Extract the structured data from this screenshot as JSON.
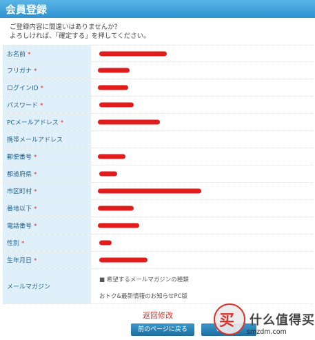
{
  "header": {
    "title": "会員登録"
  },
  "intro": {
    "line1": "ご登録内容に間違いはありませんか？",
    "line2": "よろしければ、「確定する」を押してください。"
  },
  "fields": [
    {
      "label": "お名前",
      "required": true
    },
    {
      "label": "フリガナ",
      "required": true
    },
    {
      "label": "ログインID",
      "required": true
    },
    {
      "label": "パスワード",
      "required": true
    },
    {
      "label": "PCメールアドレス",
      "required": true
    },
    {
      "label": "携帯メールアドレス",
      "required": false
    },
    {
      "label": "郵便番号",
      "required": true
    },
    {
      "label": "都道府県",
      "required": true
    },
    {
      "label": "市区町村",
      "required": true
    },
    {
      "label": "番地以下",
      "required": true
    },
    {
      "label": "電話番号",
      "required": true
    },
    {
      "label": "性別",
      "required": true
    },
    {
      "label": "生年月日",
      "required": true
    }
  ],
  "magazine": {
    "label": "メールマガジン",
    "type_line": "■ 希望するメールマガジンの種類",
    "value": "おトク&最新情報のお知らせPC版"
  },
  "required_mark": "*",
  "actions": {
    "edit_link": "返回修改",
    "back_button": "前のページに戻る",
    "confirm_button": "確定する"
  },
  "watermark": {
    "badge": "买",
    "text": "什么值得买",
    "url": "smzdm.com"
  },
  "colors": {
    "header": "#2f93d1",
    "label_bg": "#dff0fa",
    "required": "#e8302a",
    "redaction": "#e01c1c",
    "button": "#1c6fa0"
  }
}
